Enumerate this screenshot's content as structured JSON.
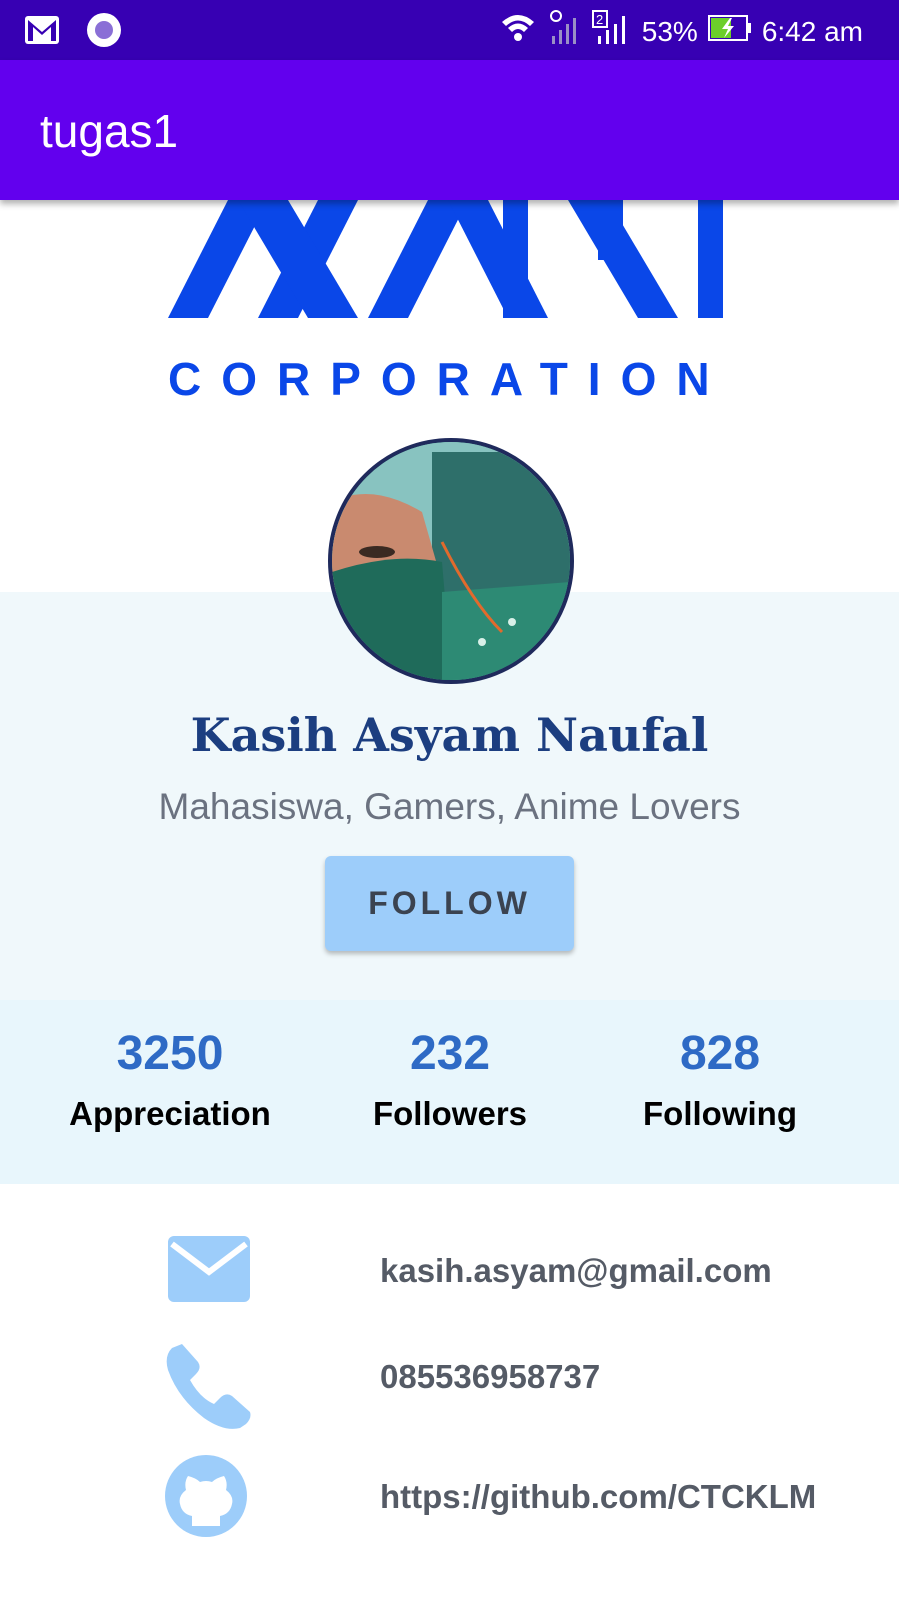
{
  "status_bar": {
    "battery": "53%",
    "time": "6:42 am",
    "icons": [
      "gmail-icon",
      "circle-app-icon",
      "wifi-icon",
      "signal-1-icon",
      "signal-2-icon",
      "battery-icon"
    ]
  },
  "app_bar": {
    "title": "tugas1"
  },
  "logo": {
    "text": "CORPORATION"
  },
  "profile": {
    "name": "Kasih Asyam Naufal",
    "subtitle": "Mahasiswa, Gamers, Anime Lovers",
    "follow_label": "FOLLOW"
  },
  "stats": [
    {
      "value": "3250",
      "label": "Appreciation"
    },
    {
      "value": "232",
      "label": "Followers"
    },
    {
      "value": "828",
      "label": "Following"
    }
  ],
  "contacts": [
    {
      "icon": "email-icon",
      "text": "kasih.asyam@gmail.com"
    },
    {
      "icon": "phone-icon",
      "text": "085536958737"
    },
    {
      "icon": "github-icon",
      "text": "https://github.com/CTCKLM"
    }
  ],
  "colors": {
    "status_bar": "#3700b3",
    "app_bar": "#6200ee",
    "logo_blue": "#0a47e8",
    "name": "#1c3e80",
    "stat_number": "#2e6ac5",
    "follow_button": "#9dcdfa",
    "icon_blue": "#9dcdfa"
  }
}
